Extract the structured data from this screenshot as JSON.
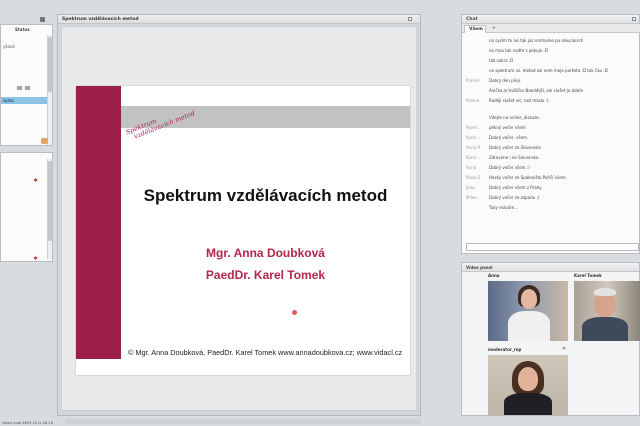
{
  "left_top_panel": {
    "column_header": "Status",
    "rows": [
      "yšová",
      "",
      "",
      "zymo",
      ""
    ]
  },
  "presentation": {
    "title": "Spektrum vzdělávacích metod",
    "slide": {
      "logo_line1": "Spektrum",
      "logo_line2": "vzdělávacích metod",
      "heading": "Spektrum vzdělávacích metod",
      "author1": "Mgr. Anna Doubková",
      "author2": "PaedDr. Karel Tomek",
      "footer": "© Mgr. Anna Doubková, PaedDr. Karel Tomek     www.annadoubkova.cz; www.vidacl.cz"
    }
  },
  "chat": {
    "title": "Chat",
    "tab_active": "Všem",
    "tab_add": "+",
    "messages": [
      {
        "who": "",
        "text": "no syslm to asi tak jaz normalne po sloucaksch"
      },
      {
        "who": "",
        "text": "no max tak vodte z pokuje :D"
      },
      {
        "who": "",
        "text": "tak sakra :D"
      },
      {
        "who": "",
        "text": "no spektrum vz. metod asi nem moje parketa :D tak čau :D"
      },
      {
        "who": "Promin",
        "text": "Dobrý den přeji."
      },
      {
        "who": "",
        "text": "Anička je trošičku Naeddljší, ale slušet je dobře"
      },
      {
        "who": "Pavina",
        "text": "Raději slušet víc, než máslo :)"
      },
      {
        "who": "",
        "text": ""
      },
      {
        "who": "",
        "text": "Vítejte na online_diskuze."
      },
      {
        "who": "Pavel ...",
        "text": "pěkný večer všem"
      },
      {
        "who": "Karel ...",
        "text": "Dobrý večer, všem."
      },
      {
        "who": "Anna P.",
        "text": "Dobrý večer ze Slovenska"
      },
      {
        "who": "Karel ...",
        "text": "Zdravíme i ne Slovensko."
      },
      {
        "who": "Anna",
        "text": "Dobrý večer všem :)"
      },
      {
        "who": "Pavla S.",
        "text": "Hezký večer ze Spáleništo Poříčí všem"
      },
      {
        "who": "Jana",
        "text": "Dobrý večer všem z Prahy."
      },
      {
        "who": "Milan ...",
        "text": "Dobrý večer ze západu ;)"
      },
      {
        "who": "",
        "text": "Tuky mávám..."
      }
    ]
  },
  "video": {
    "title": "Video panel",
    "tiles": [
      {
        "name": "Anna"
      },
      {
        "name": "Karel Tomek"
      },
      {
        "name": "moderator_rop"
      }
    ],
    "close_glyph": "✕"
  },
  "status_bar": {
    "text": "vidacl.auta 6603-2012-06-18"
  },
  "colors": {
    "slide_accent": "#9c1f4a",
    "author_text": "#b3264a"
  }
}
